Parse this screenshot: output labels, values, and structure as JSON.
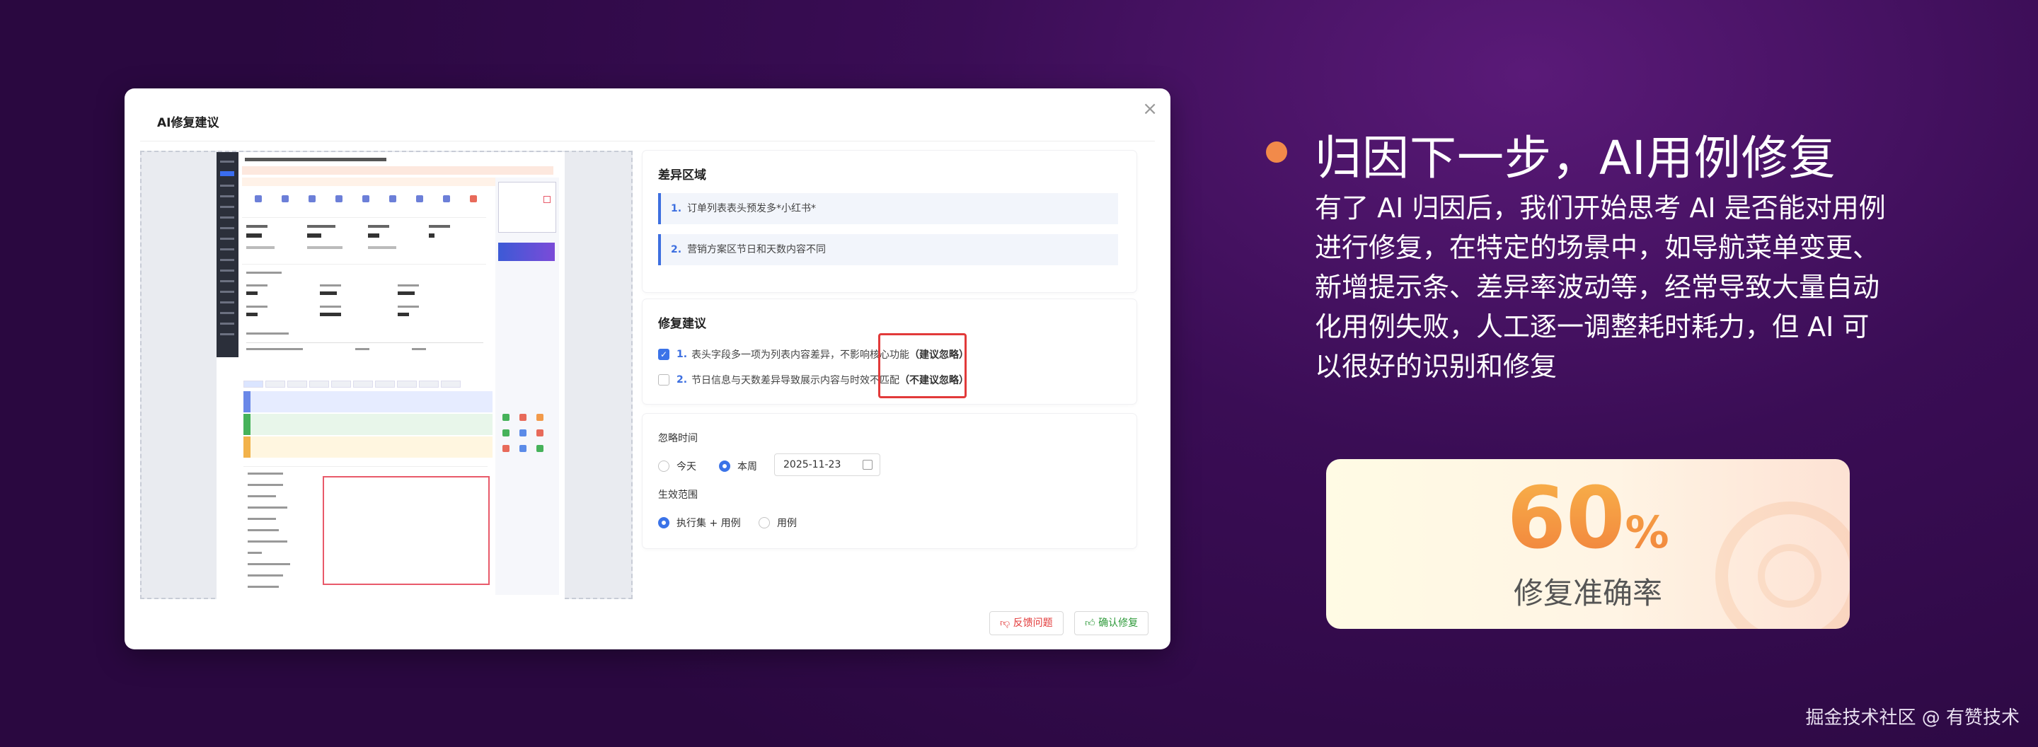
{
  "modal": {
    "title": "AI修复建议",
    "close_symbol": "×",
    "diff_section": {
      "title": "差异区域",
      "items": [
        {
          "num": "1.",
          "text": "订单列表表头预发多*小红书*"
        },
        {
          "num": "2.",
          "text": "营销方案区节日和天数内容不同"
        }
      ]
    },
    "fix_section": {
      "title": "修复建议",
      "items": [
        {
          "num": "1.",
          "text": "表头字段多一项为列表内容差异，不影响核心功能",
          "tag": "（建议忽略）",
          "checked": true
        },
        {
          "num": "2.",
          "text": "节日信息与天数差异导致展示内容与时效不匹配",
          "tag": "（不建议忽略）",
          "checked": false
        }
      ]
    },
    "ignore_time": {
      "label": "忽略时间",
      "options": [
        "今天",
        "本周"
      ],
      "selected": "本周",
      "date_value": "2025-11-23"
    },
    "scope": {
      "label": "生效范围",
      "options": [
        "执行集 + 用例",
        "用例"
      ],
      "selected": "执行集 + 用例"
    },
    "buttons": {
      "feedback": "反馈问题",
      "confirm": "确认修复"
    }
  },
  "slide": {
    "headline": "归因下一步，AI用例修复",
    "description": "有了 AI 归因后，我们开始思考 AI 是否能对用例进行修复，在特定的场景中，如导航菜单变更、新增提示条、差异率波动等，经常导致大量自动化用例失败，人工逐一调整耗时耗力，但 AI 可以很好的识别和修复",
    "stat": {
      "value": "60",
      "unit": "%",
      "label": "修复准确率"
    },
    "footer": "掘金技术社区 @ 有赞技术"
  },
  "icons": {
    "close": "close-icon",
    "calendar": "calendar-icon",
    "feedback": "thumbs-down-icon",
    "confirm": "thumbs-up-icon",
    "bullet": "bullet-dot-icon",
    "gauge": "gauge-icon"
  },
  "colors": {
    "accent_blue": "#3b73e8",
    "highlight_red": "#e23a3a",
    "confirm_green": "#2e9a3a",
    "bullet_orange": "#f28a4a",
    "stat_orange": "#f07a3a"
  }
}
